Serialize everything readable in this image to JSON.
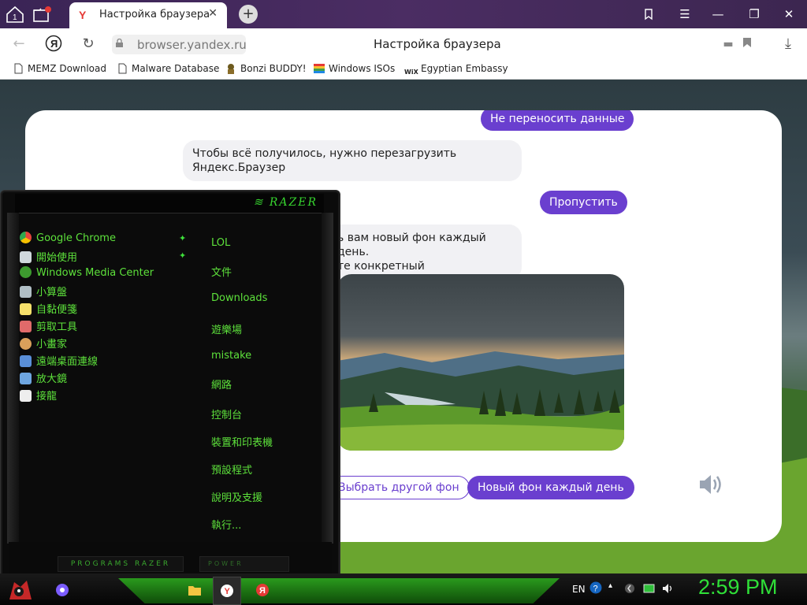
{
  "browser": {
    "tab_counter": "1",
    "active_tab": {
      "title": "Настройка браузера",
      "favicon": "Y"
    },
    "address": {
      "url": "browser.yandex.ru",
      "page_title": "Настройка браузера"
    },
    "bookmarks": [
      {
        "label": "MEMZ Download",
        "icon": "page-icon"
      },
      {
        "label": "Malware Database",
        "icon": "page-icon"
      },
      {
        "label": "Bonzi BUDDY!",
        "icon": "bonzi-icon"
      },
      {
        "label": "Windows ISOs",
        "icon": "windows-flag-icon"
      },
      {
        "label": "Egyptian Embassy",
        "icon": "wix-icon",
        "icon_text": "WiX"
      }
    ]
  },
  "chat": {
    "msg_user_1": "Не переносить данные",
    "msg_bot_1_line1": "Чтобы всё получилось, нужно перезагрузить",
    "msg_bot_1_line2": "Яндекс.Браузер",
    "msg_user_2": "Пропустить",
    "msg_bot_2_line1": "ь вам новый фон каждый день.",
    "msg_bot_2_line2": "те конкретный",
    "btn_choose_other": "Выбрать другой фон",
    "btn_new_each_day": "Новый фон каждый день"
  },
  "start_menu": {
    "logo": "RAZER",
    "programs": [
      {
        "label": "Google Chrome",
        "icon": "chrome-icon",
        "color": "#e8453c"
      },
      {
        "label": "開始使用",
        "icon": "getting-started-icon",
        "color": "#cfd8dc"
      },
      {
        "label": "Windows Media Center",
        "icon": "media-center-icon",
        "color": "#3d9b2f"
      },
      {
        "label": "小算盤",
        "icon": "calculator-icon",
        "color": "#b0bec5"
      },
      {
        "label": "自黏便箋",
        "icon": "sticky-notes-icon",
        "color": "#f5e06b"
      },
      {
        "label": "剪取工具",
        "icon": "snipping-tool-icon",
        "color": "#e06a6a"
      },
      {
        "label": "小畫家",
        "icon": "paint-icon",
        "color": "#d9a05b"
      },
      {
        "label": "遠端桌面連線",
        "icon": "remote-desktop-icon",
        "color": "#5a8fd8"
      },
      {
        "label": "放大鏡",
        "icon": "magnifier-icon",
        "color": "#6ea5e0"
      },
      {
        "label": "接龍",
        "icon": "solitaire-icon",
        "color": "#eeeeee"
      }
    ],
    "places": [
      "LOL",
      "文件",
      "Downloads",
      "遊樂場",
      "mistake",
      "網路",
      "控制台",
      "裝置和印表機",
      "預設程式",
      "說明及支援",
      "執行..."
    ],
    "programs_bar": "PROGRAMS RAZER",
    "power_bar": "POWER"
  },
  "taskbar": {
    "language": "EN",
    "clock": "2:59 PM"
  },
  "colors": {
    "accent_purple": "#6a3fcf",
    "razer_green": "#5de13b",
    "clock_green": "#2fe038"
  }
}
